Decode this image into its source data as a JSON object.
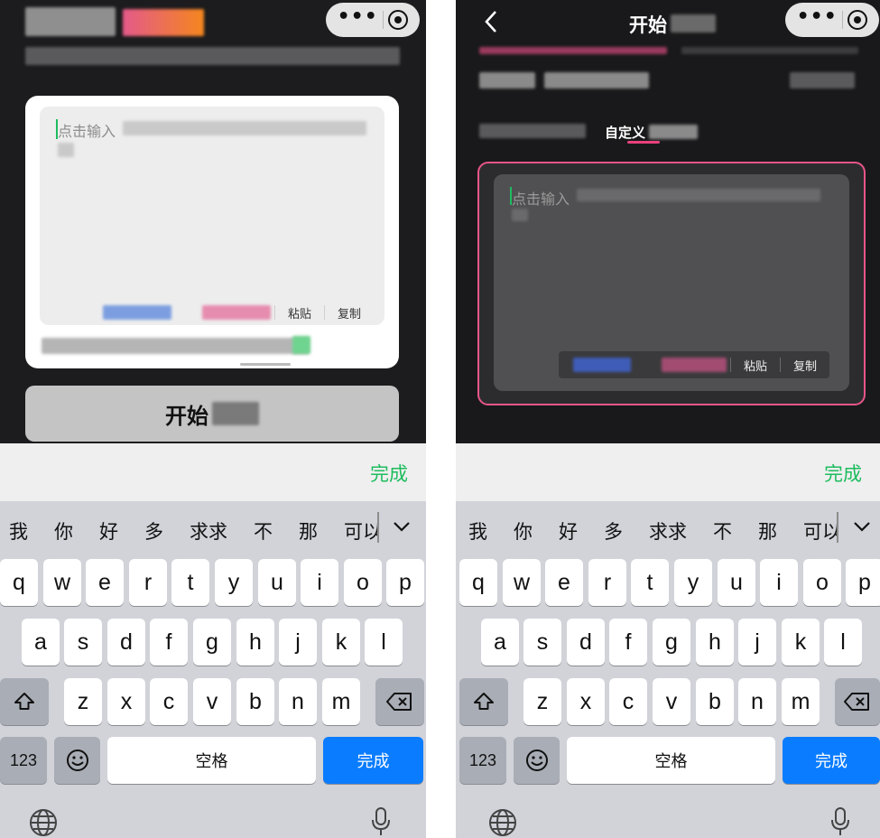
{
  "left": {
    "input_placeholder": "点击输入",
    "paste_label": "粘贴",
    "copy_label": "复制",
    "start_button_label": "开始"
  },
  "right": {
    "header_title": "开始",
    "tab_custom_label": "自定义",
    "input_placeholder": "点击输入",
    "paste_label": "粘贴",
    "copy_label": "复制"
  },
  "keyboard": {
    "accessory_done_label": "完成",
    "candidates": [
      "我",
      "你",
      "好",
      "多",
      "求求",
      "不",
      "那",
      "可以"
    ],
    "rows": [
      [
        "q",
        "w",
        "e",
        "r",
        "t",
        "y",
        "u",
        "i",
        "o",
        "p"
      ],
      [
        "a",
        "s",
        "d",
        "f",
        "g",
        "h",
        "j",
        "k",
        "l"
      ],
      [
        "z",
        "x",
        "c",
        "v",
        "b",
        "n",
        "m"
      ]
    ],
    "numbers_key_label": "123",
    "space_label": "空格",
    "return_label": "完成"
  },
  "icons": {
    "more": "more-dots-icon",
    "close": "target-close-icon",
    "back": "chevron-left-icon",
    "collapse": "chevron-down-icon",
    "shift": "shift-icon",
    "delete": "delete-icon",
    "emoji": "emoji-icon",
    "globe": "globe-icon",
    "mic": "microphone-icon"
  },
  "colors": {
    "accent_green": "#1ebc5e",
    "highlight_pink": "#e8558a",
    "return_blue": "#0a7cff"
  }
}
